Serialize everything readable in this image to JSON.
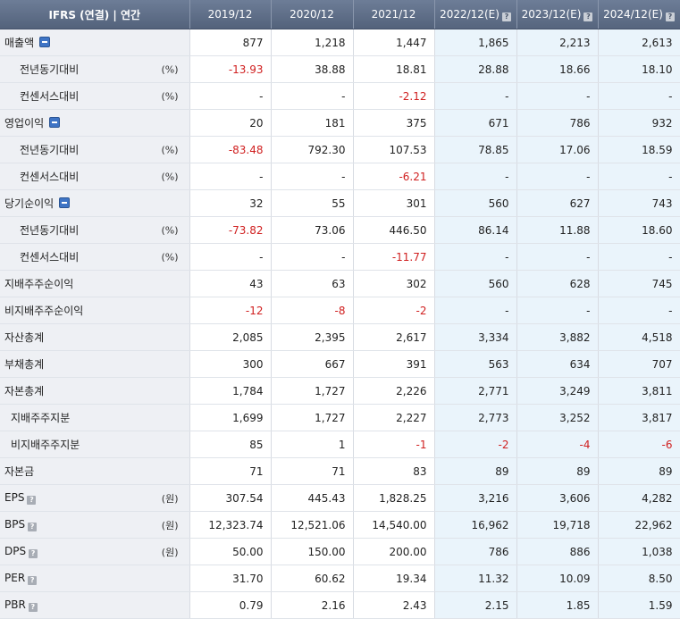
{
  "header": {
    "title": "IFRS (연결) | 연간",
    "columns": [
      {
        "label": "2019/12",
        "estimate": false
      },
      {
        "label": "2020/12",
        "estimate": false
      },
      {
        "label": "2021/12",
        "estimate": false
      },
      {
        "label": "2022/12(E)",
        "estimate": true
      },
      {
        "label": "2023/12(E)",
        "estimate": true
      },
      {
        "label": "2024/12(E)",
        "estimate": true
      }
    ]
  },
  "rows": [
    {
      "label": "매출액",
      "level": 0,
      "toggle": true,
      "help": false,
      "unit": "",
      "values": [
        "877",
        "1,218",
        "1,447",
        "1,865",
        "2,213",
        "2,613"
      ]
    },
    {
      "label": "전년동기대비",
      "level": 1,
      "toggle": false,
      "help": false,
      "unit": "(%)",
      "values": [
        "-13.93",
        "38.88",
        "18.81",
        "28.88",
        "18.66",
        "18.10"
      ]
    },
    {
      "label": "컨센서스대비",
      "level": 1,
      "toggle": false,
      "help": false,
      "unit": "(%)",
      "values": [
        "-",
        "-",
        "-2.12",
        "-",
        "-",
        "-"
      ]
    },
    {
      "label": "영업이익",
      "level": 0,
      "toggle": true,
      "help": false,
      "unit": "",
      "values": [
        "20",
        "181",
        "375",
        "671",
        "786",
        "932"
      ]
    },
    {
      "label": "전년동기대비",
      "level": 1,
      "toggle": false,
      "help": false,
      "unit": "(%)",
      "values": [
        "-83.48",
        "792.30",
        "107.53",
        "78.85",
        "17.06",
        "18.59"
      ]
    },
    {
      "label": "컨센서스대비",
      "level": 1,
      "toggle": false,
      "help": false,
      "unit": "(%)",
      "values": [
        "-",
        "-",
        "-6.21",
        "-",
        "-",
        "-"
      ]
    },
    {
      "label": "당기순이익",
      "level": 0,
      "toggle": true,
      "help": false,
      "unit": "",
      "values": [
        "32",
        "55",
        "301",
        "560",
        "627",
        "743"
      ]
    },
    {
      "label": "전년동기대비",
      "level": 1,
      "toggle": false,
      "help": false,
      "unit": "(%)",
      "values": [
        "-73.82",
        "73.06",
        "446.50",
        "86.14",
        "11.88",
        "18.60"
      ]
    },
    {
      "label": "컨센서스대비",
      "level": 1,
      "toggle": false,
      "help": false,
      "unit": "(%)",
      "values": [
        "-",
        "-",
        "-11.77",
        "-",
        "-",
        "-"
      ]
    },
    {
      "label": "지배주주순이익",
      "level": 0,
      "toggle": false,
      "help": false,
      "unit": "",
      "values": [
        "43",
        "63",
        "302",
        "560",
        "628",
        "745"
      ]
    },
    {
      "label": "비지배주주순이익",
      "level": 0,
      "toggle": false,
      "help": false,
      "unit": "",
      "values": [
        "-12",
        "-8",
        "-2",
        "-",
        "-",
        "-"
      ]
    },
    {
      "label": "자산총계",
      "level": 0,
      "toggle": false,
      "help": false,
      "unit": "",
      "values": [
        "2,085",
        "2,395",
        "2,617",
        "3,334",
        "3,882",
        "4,518"
      ]
    },
    {
      "label": "부채총계",
      "level": 0,
      "toggle": false,
      "help": false,
      "unit": "",
      "values": [
        "300",
        "667",
        "391",
        "563",
        "634",
        "707"
      ]
    },
    {
      "label": "자본총계",
      "level": 0,
      "toggle": false,
      "help": false,
      "unit": "",
      "values": [
        "1,784",
        "1,727",
        "2,226",
        "2,771",
        "3,249",
        "3,811"
      ]
    },
    {
      "label": "지배주주지분",
      "level": 2,
      "toggle": false,
      "help": false,
      "unit": "",
      "values": [
        "1,699",
        "1,727",
        "2,227",
        "2,773",
        "3,252",
        "3,817"
      ]
    },
    {
      "label": "비지배주주지분",
      "level": 2,
      "toggle": false,
      "help": false,
      "unit": "",
      "values": [
        "85",
        "1",
        "-1",
        "-2",
        "-4",
        "-6"
      ]
    },
    {
      "label": "자본금",
      "level": 0,
      "toggle": false,
      "help": false,
      "unit": "",
      "values": [
        "71",
        "71",
        "83",
        "89",
        "89",
        "89"
      ]
    },
    {
      "label": "EPS",
      "level": 0,
      "toggle": false,
      "help": true,
      "unit": "(원)",
      "values": [
        "307.54",
        "445.43",
        "1,828.25",
        "3,216",
        "3,606",
        "4,282"
      ]
    },
    {
      "label": "BPS",
      "level": 0,
      "toggle": false,
      "help": true,
      "unit": "(원)",
      "values": [
        "12,323.74",
        "12,521.06",
        "14,540.00",
        "16,962",
        "19,718",
        "22,962"
      ]
    },
    {
      "label": "DPS",
      "level": 0,
      "toggle": false,
      "help": true,
      "unit": "(원)",
      "values": [
        "50.00",
        "150.00",
        "200.00",
        "786",
        "886",
        "1,038"
      ]
    },
    {
      "label": "PER",
      "level": 0,
      "toggle": false,
      "help": true,
      "unit": "",
      "values": [
        "31.70",
        "60.62",
        "19.34",
        "11.32",
        "10.09",
        "8.50"
      ]
    },
    {
      "label": "PBR",
      "level": 0,
      "toggle": false,
      "help": true,
      "unit": "",
      "values": [
        "0.79",
        "2.16",
        "2.43",
        "2.15",
        "1.85",
        "1.59"
      ]
    }
  ],
  "colors": {
    "negative": "#d02020",
    "estimate_bg": "#eaf4fb",
    "label_bg": "#eef0f4",
    "header_bg": "#5e6e88",
    "toggle": "#3e74c5"
  }
}
